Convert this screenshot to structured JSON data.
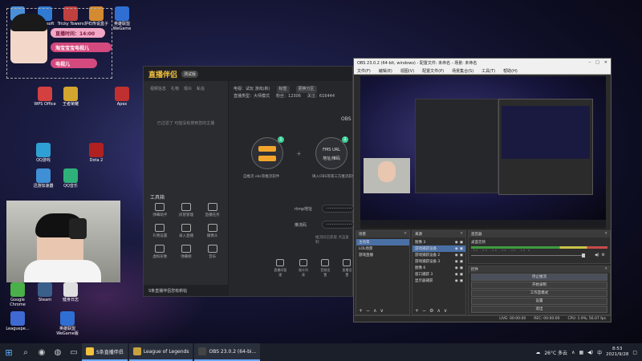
{
  "desktop": {
    "icons": [
      {
        "label": "此电脑",
        "color": "#4a8fd8"
      },
      {
        "label": "Microsoft",
        "color": "#2f7bd4"
      },
      {
        "label": "Tricky Towers",
        "color": "#c04040"
      },
      {
        "label": "炉石传说盒子",
        "color": "#d48a2f"
      },
      {
        "label": "英雄联盟 WeGame",
        "color": "#2f6fd4"
      },
      {
        "label": "WPS Office",
        "color": "#d43f3f"
      },
      {
        "label": "王者荣耀",
        "color": "#d4a52f"
      },
      {
        "label": "Apex",
        "color": "#c03030"
      },
      {
        "label": "QQ游戏",
        "color": "#2fa0d4"
      },
      {
        "label": "Dota 2",
        "color": "#b02020"
      },
      {
        "label": "迅游加速器",
        "color": "#3f8fd4"
      },
      {
        "label": "QQ音乐",
        "color": "#2fb07a"
      },
      {
        "label": "Google Chrome",
        "color": "#4ab04a"
      },
      {
        "label": "Steam",
        "color": "#3a5f8a"
      },
      {
        "label": "健身日志",
        "color": "#e0e0e0"
      },
      {
        "label": "Leaguepe...",
        "color": "#3f6ad4"
      },
      {
        "label": "英雄联盟 WeGame版",
        "color": "#2f6fd4"
      }
    ]
  },
  "overlay": {
    "pill1": "直播时间：14:00",
    "pill2": "淘宝宝宝电视儿",
    "pill3": "电视儿"
  },
  "livepartner": {
    "title": "直播伴侣",
    "badge": "测试版",
    "left_tabs": [
      "视频信息",
      "礼物",
      "观众",
      "私信"
    ],
    "tip": "已过滤了 可能没有搜到您的主播",
    "tools_title": "工具箱",
    "tools": [
      {
        "label": "弹幕助手"
      },
      {
        "label": "房管管理"
      },
      {
        "label": "直播任务"
      },
      {
        "label": "礼物设置"
      },
      {
        "label": "录入直播"
      },
      {
        "label": "摄像头"
      },
      {
        "label": "虚拟形象"
      },
      {
        "label": "弹幕姬"
      },
      {
        "label": "音乐"
      }
    ],
    "bottom": "S条直播伴侣您有新帖",
    "info_line1": [
      "电视：试玩 游戏(新)",
      "标签",
      "更换分区"
    ],
    "info_line2": [
      "直播类型：大师模式",
      "粉丝：12306",
      "关注：616444"
    ],
    "modes": [
      {
        "num": "1",
        "caption": "自推流 obs等推流软件"
      },
      {
        "num": "2",
        "caption": "填入OBS等第三方推流软件",
        "title": "FMS URL",
        "sub": "地址/推码"
      }
    ],
    "obs_label": "OBS",
    "rtmp_label": "rtmp地址",
    "key_label": "推流码",
    "rtmp_placeholder": "••••••••••••••",
    "key_placeholder": "••••••••••••••",
    "key_hint": "推流码已获取 点击复制",
    "actions": [
      "直播间管理",
      "观众列表",
      "音频设置",
      "直播设置"
    ]
  },
  "obs": {
    "title": "OBS 23.0.2 (64-bit, windows) - 配置文件: 未命名 - 场景: 未命名",
    "menu": [
      "文件(F)",
      "编辑(E)",
      "视图(V)",
      "配置文件(P)",
      "场景集合(S)",
      "工具(T)",
      "帮助(H)"
    ],
    "scenes_title": "场景",
    "scenes": [
      "主场景",
      "LOL场景",
      "游戏直播"
    ],
    "sources_title": "来源",
    "sources": [
      "图像 3",
      "游戏捕获设备",
      "游戏捕获设备 2",
      "游戏捕获设备 3",
      "图像 6",
      "窗口捕获 3",
      "显示器捕获"
    ],
    "mixer_title": "混音器",
    "mixer_track": "桌面音频",
    "meter_scale": "-60 -50 -40 -30 -20 -10 0",
    "controls_title": "控件",
    "controls": [
      "停止推流",
      "开始录制",
      "工作室模式",
      "设置",
      "退出"
    ],
    "status": [
      "LIVE: 00:00:00",
      "REC: 00:00:00",
      "CPU: 1.9%, 56.07 fps"
    ]
  },
  "taskbar": {
    "tasks": [
      {
        "label": "S条直播伴侣",
        "color": "#f3c23c"
      },
      {
        "label": "League of Legends",
        "color": "#c9a23c"
      },
      {
        "label": "OBS 23.0.2 (64-bi...",
        "color": "#444"
      }
    ],
    "weather": "26°C 多云",
    "ime": "中",
    "time": "8:53",
    "date": "2021/9/28"
  }
}
